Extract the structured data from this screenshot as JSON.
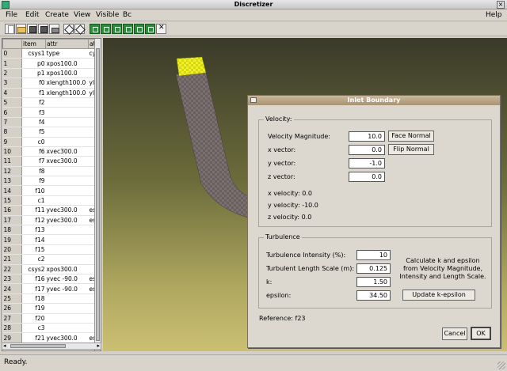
{
  "window": {
    "title": "Discretizer"
  },
  "menu": {
    "file": "File",
    "edit": "Edit",
    "create": "Create",
    "view": "View",
    "visible": "Visible",
    "bc": "Bc",
    "help": "Help"
  },
  "table": {
    "headers": [
      "",
      "item",
      "attr",
      "at"
    ],
    "rows": [
      [
        "0",
        "csys1",
        "type",
        "cyl"
      ],
      [
        "1",
        "p0",
        "xpos100.0",
        ""
      ],
      [
        "2",
        "p1",
        "xpos100.0",
        ""
      ],
      [
        "3",
        "f0",
        "xlength100.0",
        "yl"
      ],
      [
        "4",
        "f1",
        "xlength100.0",
        "yl"
      ],
      [
        "5",
        "f2",
        "",
        ""
      ],
      [
        "6",
        "f3",
        "",
        ""
      ],
      [
        "7",
        "f4",
        "",
        ""
      ],
      [
        "8",
        "f5",
        "",
        ""
      ],
      [
        "9",
        "c0",
        "",
        ""
      ],
      [
        "10",
        "f6",
        "xvec300.0",
        ""
      ],
      [
        "11",
        "f7",
        "xvec300.0",
        ""
      ],
      [
        "12",
        "f8",
        "",
        ""
      ],
      [
        "13",
        "f9",
        "",
        ""
      ],
      [
        "14",
        "f10",
        "",
        ""
      ],
      [
        "15",
        "c1",
        "",
        ""
      ],
      [
        "16",
        "f11",
        "yvec300.0",
        "es"
      ],
      [
        "17",
        "f12",
        "yvec300.0",
        "es"
      ],
      [
        "18",
        "f13",
        "",
        ""
      ],
      [
        "19",
        "f14",
        "",
        ""
      ],
      [
        "20",
        "f15",
        "",
        ""
      ],
      [
        "21",
        "c2",
        "",
        ""
      ],
      [
        "22",
        "csys2",
        "xpos300.0",
        ""
      ],
      [
        "23",
        "f16",
        "yvec -90.0",
        "es"
      ],
      [
        "24",
        "f17",
        "yvec -90.0",
        "es"
      ],
      [
        "25",
        "f18",
        "",
        ""
      ],
      [
        "26",
        "f19",
        "",
        ""
      ],
      [
        "27",
        "f20",
        "",
        ""
      ],
      [
        "28",
        "c3",
        "",
        ""
      ],
      [
        "29",
        "f21",
        "yvec300.0",
        "es"
      ]
    ]
  },
  "dialog": {
    "title": "Inlet Boundary",
    "velocity": {
      "legend": "Velocity:",
      "magnitude_label": "Velocity Magnitude:",
      "magnitude_value": "10.0",
      "x_label": "x vector:",
      "x_value": "0.0",
      "y_label": "y vector:",
      "y_value": "-1.0",
      "z_label": "z vector:",
      "z_value": "0.0",
      "face_normal": "Face Normal",
      "flip_normal": "Flip Normal",
      "x_vel": "x velocity:  0.0",
      "y_vel": "y velocity:  -10.0",
      "z_vel": "z velocity:  0.0"
    },
    "turbulence": {
      "legend": "Turbulence",
      "intensity_label": "Turbulence Intensity (%):",
      "intensity_value": "10",
      "length_label": "Turbulent Length Scale (m):",
      "length_value": "0.125",
      "k_label": "k:",
      "k_value": "1.50",
      "eps_label": "epsilon:",
      "eps_value": "34.50",
      "note": "Calculate k and epsilon from Velocity Magnitude, Intensity and Length Scale.",
      "update_button": "Update k-epsilon"
    },
    "reference": "Reference:   f23",
    "cancel": "Cancel",
    "ok": "OK"
  },
  "status": "Ready."
}
